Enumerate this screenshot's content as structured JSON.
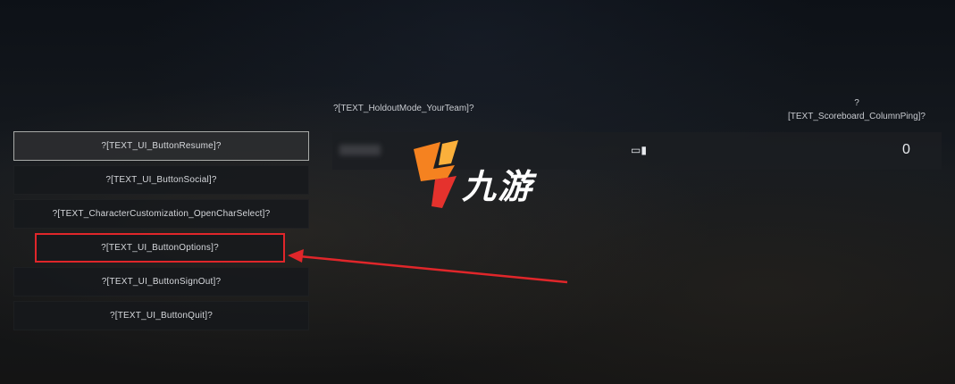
{
  "menu": {
    "items": [
      {
        "label": "?[TEXT_UI_ButtonResume]?"
      },
      {
        "label": "?[TEXT_UI_ButtonSocial]?"
      },
      {
        "label": "?[TEXT_CharacterCustomization_OpenCharSelect]?"
      },
      {
        "label": "?[TEXT_UI_ButtonOptions]?"
      },
      {
        "label": "?[TEXT_UI_ButtonSignOut]?"
      },
      {
        "label": "?[TEXT_UI_ButtonQuit]?"
      }
    ]
  },
  "scoreboard": {
    "team_header": "?[TEXT_HoldoutMode_YourTeam]?",
    "ping_header_line1": "?",
    "ping_header_line2": "[TEXT_Scoreboard_ColumnPing]?",
    "rows": [
      {
        "platform_icon": "controller-icon",
        "platform_glyph": "▭▮",
        "ping": "0"
      }
    ]
  },
  "watermark": {
    "text": "九游",
    "logo": "jiuyou-logo",
    "colors": {
      "orange": "#f58220",
      "red": "#e5322d",
      "yellow": "#fbb03b"
    }
  },
  "annotation": {
    "color": "#e0262a"
  }
}
